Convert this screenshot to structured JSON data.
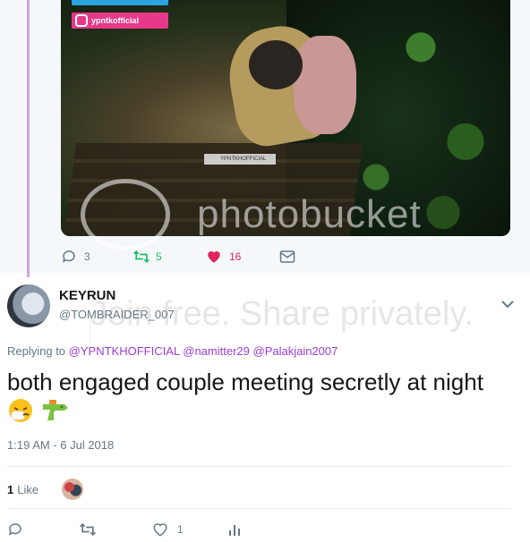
{
  "quoted_tweet": {
    "media": {
      "badge_text": "ypntkofficial",
      "small_watermark": "YPNTKHOFFICIAL"
    },
    "actions": {
      "reply_count": "3",
      "retweet_count": "5",
      "like_count": "16"
    }
  },
  "watermark": {
    "brand": "photobucket",
    "tagline": "Join free. Share privately."
  },
  "tweet": {
    "author_name": "KEYRUN",
    "author_handle": "@TOMBRAIDER_007",
    "replying_label": "Replying to",
    "replying_to": [
      "@YPNTKHOFFICIAL",
      "@namitter29",
      "@Palakjain2007"
    ],
    "text": "both engaged couple meeting secretly at night",
    "timestamp": "1:19 AM - 6 Jul 2018",
    "likes_count": "1",
    "likes_label": "Like",
    "actions": {
      "like_count": "1"
    }
  },
  "colors": {
    "thread_line": "#cfa3e6",
    "retweet_green": "#17bf63",
    "like_red": "#e0245e",
    "mention_purple": "#9b3ed1",
    "secondary_text": "#657786"
  },
  "icons": [
    "reply-icon",
    "retweet-icon",
    "heart-icon",
    "mail-icon",
    "chevron-down-icon",
    "analytics-icon",
    "instagram-icon",
    "twitter-icon"
  ]
}
